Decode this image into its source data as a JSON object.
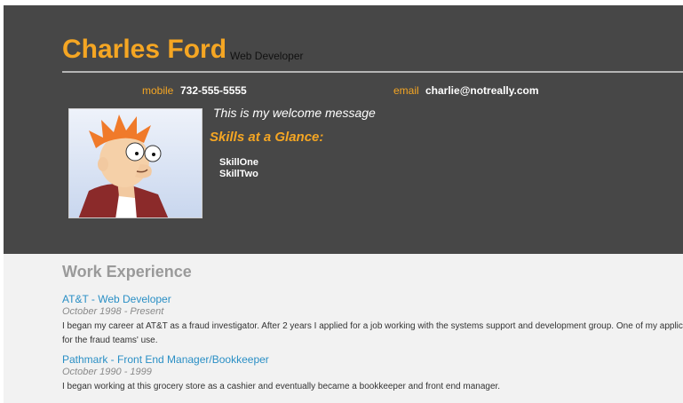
{
  "header": {
    "name": "Charles Ford",
    "role": "Web Developer",
    "contact": {
      "mobile_label": "mobile",
      "mobile_value": "732-555-5555",
      "email_label": "email",
      "email_value": "charlie@notreally.com"
    },
    "welcome": "This is my welcome message",
    "skills_title": "Skills at a Glance:",
    "skills": [
      "SkillOne",
      "SkillTwo"
    ]
  },
  "work": {
    "title": "Work Experience",
    "jobs": [
      {
        "title": "AT&T - Web Developer",
        "dates": "October 1998 - Present",
        "description": "I began my career at AT&T as a fraud investigator. After 2 years I applied for a job working with the systems support and development group. One of my applications for the fraud teams' use."
      },
      {
        "title": "Pathmark - Front End Manager/Bookkeeper",
        "dates": "October 1990 - 1999",
        "description": "I began working at this grocery store as a cashier and eventually became a bookkeeper and front end manager."
      }
    ]
  },
  "colors": {
    "header_bg": "#474747",
    "accent": "#f5a623",
    "link": "#2a8fc5",
    "page_bg": "#f2f2f2"
  }
}
